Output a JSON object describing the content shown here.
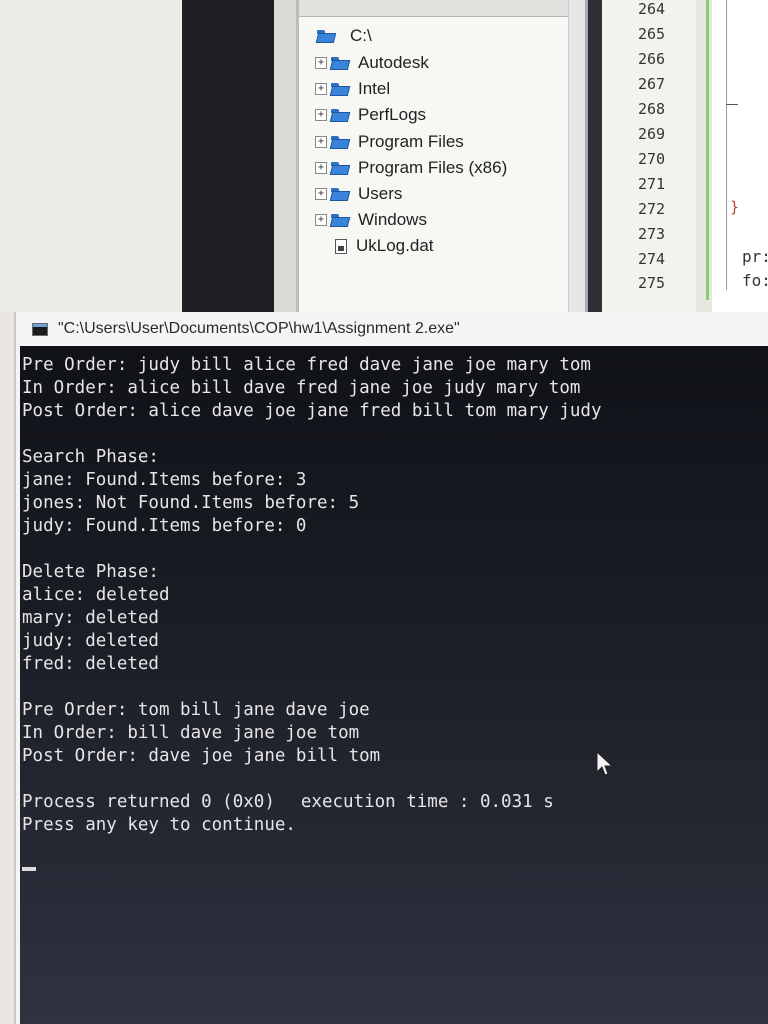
{
  "file_tree": {
    "root_label": "C:\\",
    "items": [
      {
        "label": "Autodesk",
        "type": "folder"
      },
      {
        "label": "Intel",
        "type": "folder"
      },
      {
        "label": "PerfLogs",
        "type": "folder"
      },
      {
        "label": "Program Files",
        "type": "folder"
      },
      {
        "label": "Program Files (x86)",
        "type": "folder"
      },
      {
        "label": "Users",
        "type": "folder"
      },
      {
        "label": "Windows",
        "type": "folder"
      },
      {
        "label": "UkLog.dat",
        "type": "file"
      }
    ]
  },
  "editor": {
    "line_numbers": [
      "264",
      "265",
      "266",
      "267",
      "268",
      "269",
      "270",
      "271",
      "272",
      "273",
      "274",
      "275"
    ],
    "brace": "}",
    "code_fragments": [
      "pr:",
      "fo:"
    ]
  },
  "console": {
    "title": "\"C:\\Users\\User\\Documents\\COP\\hw1\\Assignment 2.exe\"",
    "block1": [
      "Pre Order: judy bill alice fred dave jane joe mary tom",
      "In Order: alice bill dave fred jane joe judy mary tom",
      "Post Order: alice dave joe jane fred bill tom mary judy"
    ],
    "search": [
      "Search Phase:",
      "jane: Found.Items before: 3",
      "jones: Not Found.Items before: 5",
      "judy: Found.Items before: 0"
    ],
    "delete": [
      "Delete Phase:",
      "alice: deleted",
      "mary: deleted",
      "judy: deleted",
      "fred: deleted"
    ],
    "block2": [
      "Pre Order: tom bill jane dave joe",
      "In Order: bill dave jane joe tom",
      "Post Order: dave joe jane bill tom"
    ],
    "process_returned": "Process returned 0 (0x0)",
    "execution_time": "execution time : 0.031 s",
    "press_key": "Press any key to continue."
  },
  "colors": {
    "console_bg": "#181a22",
    "console_text": "#e6e6e6",
    "folder_blue": "#3a83db",
    "fold_green": "#7fd36b"
  }
}
